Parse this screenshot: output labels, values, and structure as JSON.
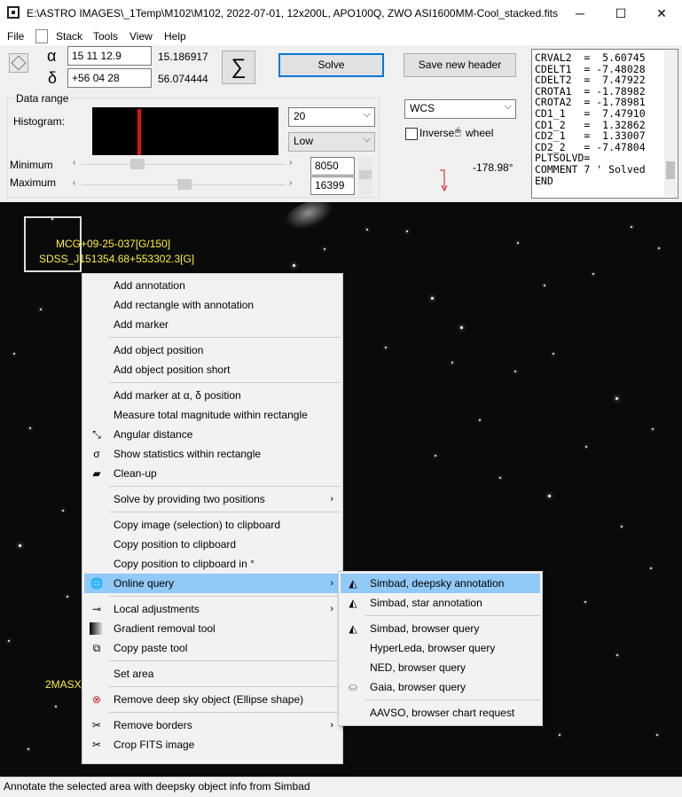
{
  "window": {
    "title": "E:\\ASTRO IMAGES\\_1Temp\\M102\\M102, 2022-07-01, 12x200L, APO100Q, ZWO ASI1600MM-Cool_stacked.fits",
    "minimize": "─",
    "maximize": "☐",
    "close": "✕"
  },
  "menu": [
    "File",
    "Stack",
    "Tools",
    "View",
    "Help"
  ],
  "coords": {
    "alpha_symbol": "α",
    "delta_symbol": "δ",
    "ra_value": "15 11 12.9",
    "ra_decimal": "15.186917",
    "dec_value": "+56 04 28",
    "dec_decimal": "56.074444",
    "sigma": "∑"
  },
  "buttons": {
    "solve": "Solve",
    "save_header": "Save new header"
  },
  "data_range": {
    "group_label": "Data range",
    "histogram_label": "Histogram:",
    "min_label": "Minimum",
    "max_label": "Maximum",
    "min_value": "8050",
    "max_value": "16399",
    "bins_value": "20",
    "scale_value": "Low"
  },
  "wcs": {
    "mode": "WCS",
    "inverse_label": "Inverse",
    "wheel_label": "wheel",
    "angle": "-178.98°"
  },
  "header_lines": [
    "CRVAL2  =  5.60745",
    "CDELT1  = -7.48028",
    "CDELT2  =  7.47922",
    "CROTA1  = -1.78982",
    "CROTA2  = -1.78981",
    "CD1_1   =  7.47910",
    "CD1_2   =  1.32862",
    "CD2_1   =  1.33007",
    "CD2_2   = -7.47804",
    "PLTSOLVD=",
    "COMMENT 7 ' Solved",
    "END"
  ],
  "annotations": {
    "a1": "MCG+09-25-037[G/150]",
    "a2": "SDSS_J151354.68+553302.3[G]",
    "a3": "2MASX_"
  },
  "context_menu": {
    "add_annotation": "Add annotation",
    "add_rect_annotation": "Add rectangle with annotation",
    "add_marker": "Add marker",
    "add_object_position": "Add object position",
    "add_object_position_short": "Add object position short",
    "add_marker_at": "Add marker at α, δ position",
    "measure_magnitude": "Measure total magnitude within rectangle",
    "angular_distance": "Angular distance",
    "show_statistics": "Show statistics within rectangle",
    "clean_up": "Clean-up",
    "solve_two_positions": "Solve by providing two positions",
    "copy_image": "Copy image (selection) to clipboard",
    "copy_position": "Copy position to clipboard",
    "copy_position_deg": "Copy position to clipboard in °",
    "online_query": "Online query",
    "local_adjustments": "Local adjustments",
    "gradient_removal": "Gradient removal tool",
    "copy_paste_tool": "Copy paste tool",
    "set_area": "Set area",
    "remove_dso": "Remove deep sky object (Ellipse shape)",
    "remove_borders": "Remove borders",
    "crop_fits": "Crop FITS image"
  },
  "submenu": {
    "simbad_deepsky": "Simbad, deepsky annotation",
    "simbad_star": "Simbad, star annotation",
    "simbad_browser": "Simbad, browser query",
    "hyperleda": "HyperLeda, browser query",
    "ned": "NED, browser query",
    "gaia": "Gaia, browser query",
    "aavso": "AAVSO, browser chart request"
  },
  "status": "Annotate the selected area with deepsky object info from Simbad",
  "colors": {
    "highlight": "#91c9f7",
    "annotation": "#ffef3a",
    "histogram_peak": "#e01010"
  }
}
